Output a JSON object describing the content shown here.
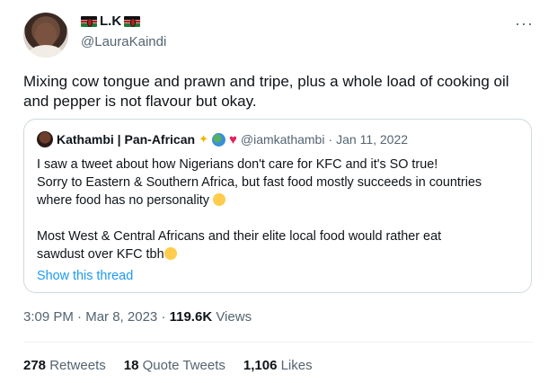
{
  "author": {
    "name": "L.K",
    "handle": "@LauraKaindi"
  },
  "tweet": {
    "text": "Mixing cow tongue and prawn and tripe, plus a whole load of cooking oil and pepper is not flavour but okay."
  },
  "quote": {
    "name": "Kathambi | Pan-African",
    "handle": "@iamkathambi",
    "separator": "·",
    "date": "Jan 11, 2022",
    "line1": "I saw a tweet about how Nigerians don't care for KFC and it's SO true!",
    "line2": "Sorry to Eastern & Southern Africa, but fast food mostly succeeds in countries",
    "line3": "where food has no personality",
    "line4": "Most West & Central Africans and their elite local food would rather eat",
    "line5": "sawdust over KFC tbh",
    "show_thread": "Show this thread"
  },
  "meta": {
    "time": "3:09 PM",
    "sep": "·",
    "date": "Mar 8, 2023",
    "sep2": "·",
    "views_count": "119.6K",
    "views_label": "Views"
  },
  "stats": [
    {
      "count": "278",
      "label": "Retweets"
    },
    {
      "count": "18",
      "label": "Quote Tweets"
    },
    {
      "count": "1,106",
      "label": "Likes"
    }
  ],
  "icons": {
    "more": "more-icon",
    "flag": "kenya-flag-icon"
  },
  "colors": {
    "link": "#1d9bf0",
    "muted": "#536471",
    "text": "#0f1419",
    "border": "#cfd9de"
  }
}
